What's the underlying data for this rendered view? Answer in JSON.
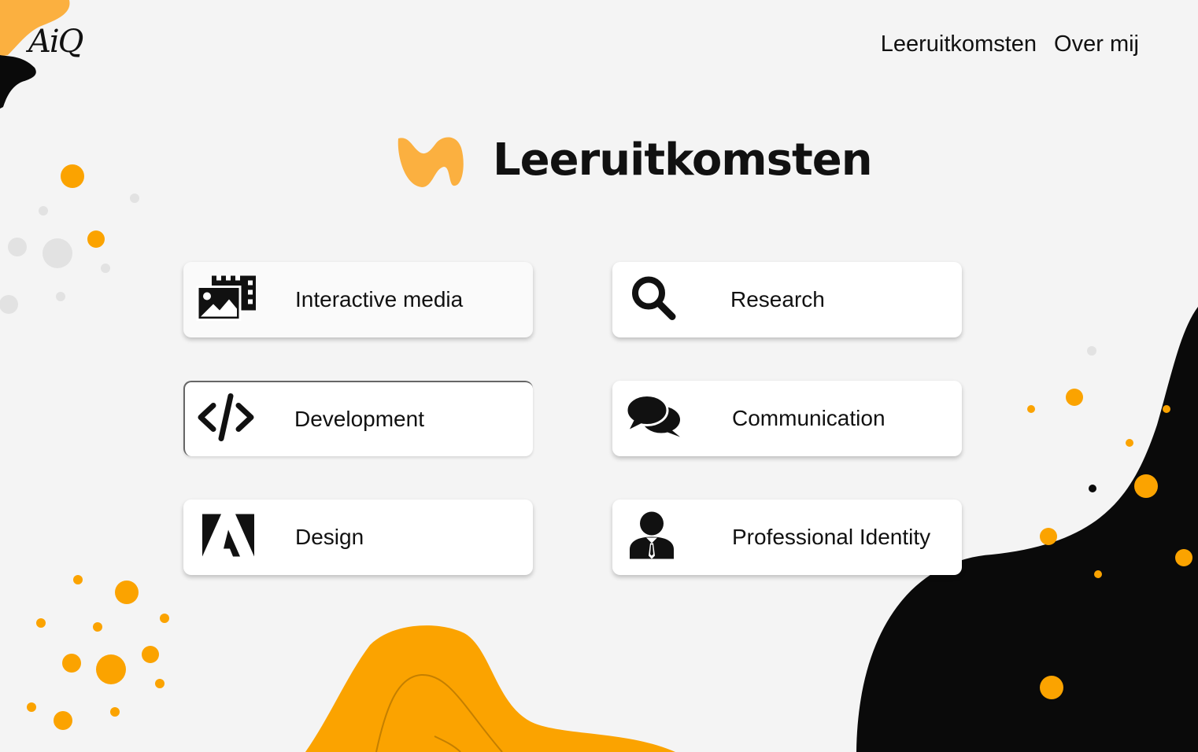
{
  "logo": {
    "text": "AiQ"
  },
  "nav": {
    "items": [
      {
        "label": "Leeruitkomsten"
      },
      {
        "label": "Over mij"
      }
    ]
  },
  "page": {
    "title": "Leeruitkomsten"
  },
  "cards": [
    {
      "label": "Interactive media",
      "icon": "media-gallery-icon"
    },
    {
      "label": "Research",
      "icon": "search-icon"
    },
    {
      "label": "Development",
      "icon": "code-icon"
    },
    {
      "label": "Communication",
      "icon": "chat-bubbles-icon"
    },
    {
      "label": "Design",
      "icon": "adobe-icon"
    },
    {
      "label": "Professional Identity",
      "icon": "user-tie-icon"
    }
  ],
  "colors": {
    "accent": "#fba300",
    "accent_light": "#fbb040",
    "dark": "#0a0a0a",
    "background": "#f4f4f4",
    "dot_grey": "#e0e0e0"
  }
}
